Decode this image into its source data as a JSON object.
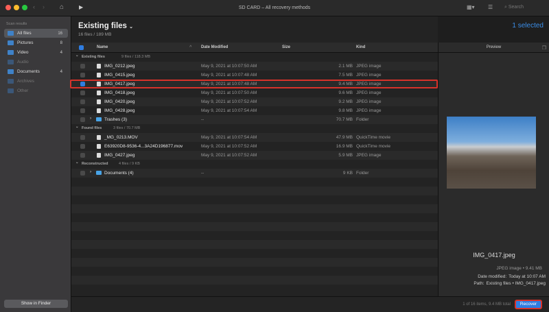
{
  "window": {
    "title": "SD CARD – All recovery methods",
    "search_placeholder": "Search"
  },
  "sidebar": {
    "heading": "Scan results",
    "items": [
      {
        "label": "All files",
        "count": "16",
        "active": true
      },
      {
        "label": "Pictures",
        "count": "8"
      },
      {
        "label": "Video",
        "count": "4"
      },
      {
        "label": "Audio",
        "count": "",
        "dim": true
      },
      {
        "label": "Documents",
        "count": "4"
      },
      {
        "label": "Archives",
        "count": "",
        "dim": true
      },
      {
        "label": "Other",
        "count": "",
        "dim": true
      }
    ],
    "show_in_finder": "Show in Finder"
  },
  "main": {
    "title": "Existing files",
    "subtitle": "16 files / 189 MB",
    "selected": "1 selected",
    "columns": {
      "name": "Name",
      "date": "Date Modified",
      "size": "Size",
      "kind": "Kind"
    },
    "rows": [
      {
        "group": "Existing files",
        "info": "9 files / 118.3 MB"
      },
      {
        "name": "IMG_0212.jpeg",
        "date": "May 9, 2021 at 10:07:50 AM",
        "size": "2.1 MB",
        "kind": "JPEG image"
      },
      {
        "name": "IMG_0415.jpeg",
        "date": "May 9, 2021 at 10:07:48 AM",
        "size": "7.5 MB",
        "kind": "JPEG image"
      },
      {
        "name": "IMG_0417.jpeg",
        "date": "May 9, 2021 at 10:07:48 AM",
        "size": "9.4 MB",
        "kind": "JPEG image",
        "checked": true
      },
      {
        "name": "IMG_0418.jpeg",
        "date": "May 9, 2021 at 10:07:50 AM",
        "size": "9.6 MB",
        "kind": "JPEG image"
      },
      {
        "name": "IMG_0420.jpeg",
        "date": "May 9, 2021 at 10:07:52 AM",
        "size": "9.2 MB",
        "kind": "JPEG image"
      },
      {
        "name": "IMG_0428.jpeg",
        "date": "May 9, 2021 at 10:07:54 AM",
        "size": "9.8 MB",
        "kind": "JPEG image"
      },
      {
        "name": "Trashes (3)",
        "date": "--",
        "size": "70.7 MB",
        "kind": "Folder",
        "folder": true
      },
      {
        "group": "Found files",
        "info": "3 files / 70.7 MB"
      },
      {
        "name": "_MG_0213.MOV",
        "date": "May 9, 2021 at 10:07:54 AM",
        "size": "47.9 MB",
        "kind": "QuickTime movie"
      },
      {
        "name": "E63920D8-9536-4...3A24D196877.mov",
        "date": "May 9, 2021 at 10:07:52 AM",
        "size": "16.9 MB",
        "kind": "QuickTime movie"
      },
      {
        "name": "IMG_0427.jpeg",
        "date": "May 9, 2021 at 10:07:52 AM",
        "size": "5.9 MB",
        "kind": "JPEG image"
      },
      {
        "group": "Reconstructed",
        "info": "4 files / 9 KB"
      },
      {
        "name": "Documents (4)",
        "date": "--",
        "size": "9 KB",
        "kind": "Folder",
        "folder": true
      }
    ]
  },
  "preview": {
    "header": "Preview",
    "filename": "IMG_0417.jpeg",
    "type_size": "JPEG image • 9.41 MB",
    "date_label": "Date modified:",
    "date_value": "Today at 10:07 AM",
    "path_label": "Path:",
    "path_value": "Existing files • IMG_0417.jpeg"
  },
  "footer": {
    "status": "1 of 16 items, 9.4 MB total",
    "recover": "Recover"
  }
}
